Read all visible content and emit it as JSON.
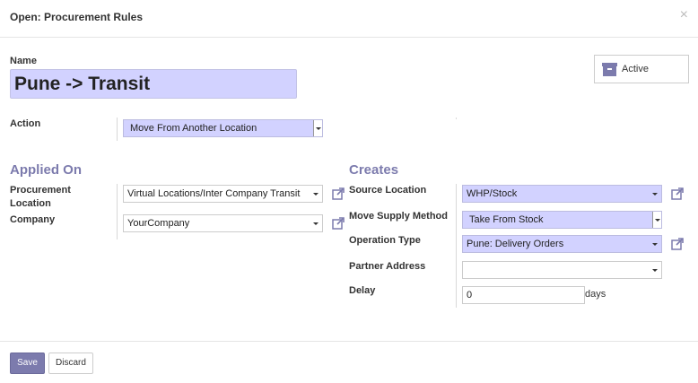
{
  "dialog": {
    "title": "Open: Procurement Rules",
    "close_glyph": "×"
  },
  "name": {
    "label": "Name",
    "value": "Pune -> Transit"
  },
  "active_button": {
    "label": "Active",
    "icon": "archive-icon"
  },
  "action": {
    "label": "Action",
    "value": "Move From Another Location"
  },
  "applied_on": {
    "title": "Applied On",
    "procurement_location": {
      "label_line1": "Procurement",
      "label_line2": "Location",
      "value": "Virtual Locations/Inter Company Transit"
    },
    "company": {
      "label": "Company",
      "value": "YourCompany"
    }
  },
  "creates": {
    "title": "Creates",
    "source_location": {
      "label": "Source Location",
      "value": "WHP/Stock"
    },
    "move_supply_method": {
      "label": "Move Supply Method",
      "value": "Take From Stock"
    },
    "operation_type": {
      "label": "Operation Type",
      "value": "Pune: Delivery Orders"
    },
    "partner_address": {
      "label": "Partner Address",
      "value": ""
    },
    "delay": {
      "label": "Delay",
      "value": "0",
      "unit": "days"
    }
  },
  "footer": {
    "save_label": "Save",
    "discard_label": "Discard"
  },
  "colors": {
    "accent": "#7c7bad",
    "required_field": "#d2d2ff"
  }
}
